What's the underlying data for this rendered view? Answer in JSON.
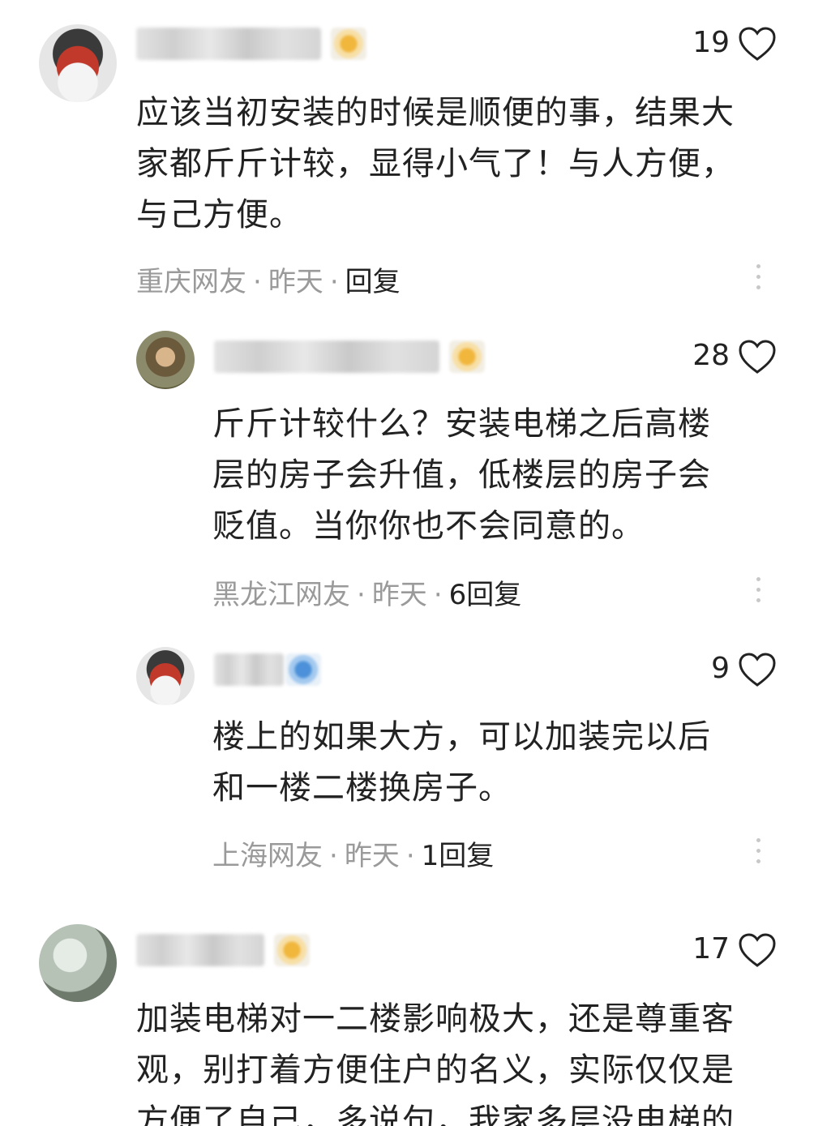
{
  "comments": [
    {
      "likes": "19",
      "text_lines": [
        "应该当初安装的时候是顺便的事，结果大",
        "家都斤斤计较，显得小气了！与人方便，",
        "与己方便。"
      ],
      "location": "重庆网友",
      "time": "昨天",
      "reply_label": "回复"
    },
    {
      "likes": "28",
      "text_lines": [
        "斤斤计较什么？安装电梯之后高楼",
        "层的房子会升值，低楼层的房子会",
        "贬值。当你你也不会同意的。"
      ],
      "location": "黑龙江网友",
      "time": "昨天",
      "reply_label": "6回复"
    },
    {
      "likes": "9",
      "text_lines": [
        "楼上的如果大方，可以加装完以后",
        "和一楼二楼换房子。"
      ],
      "location": "上海网友",
      "time": "昨天",
      "reply_label": "1回复"
    },
    {
      "likes": "17",
      "text_lines": [
        "加装电梯对一二楼影响极大，还是尊重客",
        "观，别打着方便住户的名义，实际仅仅是",
        "方便了自己，多说句，我家多层没电梯的"
      ],
      "location": "",
      "time": "",
      "reply_label": ""
    }
  ],
  "separator": "·"
}
